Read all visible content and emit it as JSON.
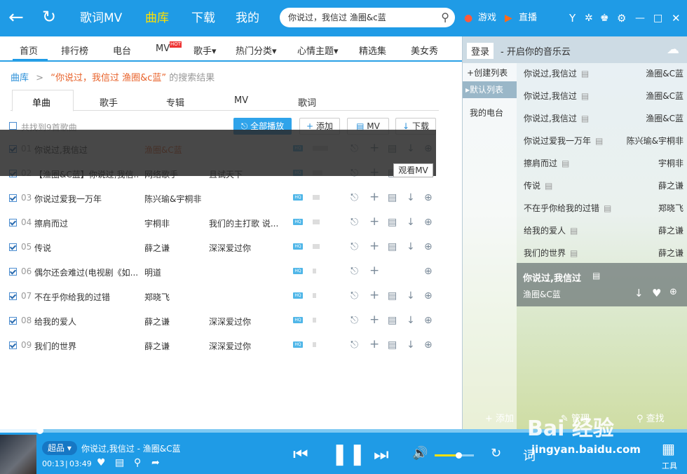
{
  "topbar": {
    "nav": [
      "歌词MV",
      "曲库",
      "下载",
      "我的"
    ],
    "active_nav": "曲库",
    "search_value": "你说过，我信过   渔圈&c蓝",
    "game_label": "游戏",
    "live_label": "直播"
  },
  "subnav": [
    "首页",
    "排行榜",
    "电台",
    "MV",
    "歌手▾",
    "热门分类▾",
    "心情主题▾",
    "精选集",
    "美女秀"
  ],
  "subnav_badge": "HOT",
  "breadcrumb": {
    "root": "曲库",
    "sep": ">",
    "query": "“你说过，我信过 渔圈&c蓝”",
    "suffix": "的搜索结果"
  },
  "tabs": [
    "单曲",
    "歌手",
    "专辑",
    "MV",
    "歌词"
  ],
  "header": {
    "found_text": "共找到9首歌曲",
    "play_all": "全部播放",
    "add": "添加",
    "mv": "MV",
    "download": "下载"
  },
  "songs": [
    {
      "no": "01",
      "title": "你说过,我信过",
      "artist": "渔圈&C蓝",
      "album": "",
      "bar": 0.9
    },
    {
      "no": "02",
      "title": "【渔圈&C蓝】你说过,我信...",
      "artist": "网络歌手",
      "album": "且试天下",
      "bar": 0.6
    },
    {
      "no": "03",
      "title": "你说过爱我一万年",
      "artist": "陈兴瑜&宇桐非",
      "album": "",
      "bar": 0.4
    },
    {
      "no": "04",
      "title": "擦肩而过",
      "artist": "宇桐非",
      "album": "我们的主打歌 说...",
      "bar": 0.4
    },
    {
      "no": "05",
      "title": "传说",
      "artist": "薛之谦",
      "album": "深深爱过你",
      "bar": 0.4
    },
    {
      "no": "06",
      "title": "偶尔还会难过(电视剧《如...",
      "artist": "明道",
      "album": "",
      "bar": 0.2
    },
    {
      "no": "07",
      "title": "不在乎你给我的过错",
      "artist": "郑晓飞",
      "album": "",
      "bar": 0.2
    },
    {
      "no": "08",
      "title": "给我的爱人",
      "artist": "薛之谦",
      "album": "深深爱过你",
      "bar": 0.2
    },
    {
      "no": "09",
      "title": "我们的世界",
      "artist": "薛之谦",
      "album": "深深爱过你",
      "bar": 0.2
    }
  ],
  "tooltip": "观看MV",
  "right_panel": {
    "login": "登录",
    "slogan": "- 开启你的音乐云",
    "create_list": "创建列表",
    "default_list": "默认列表",
    "my_radio": "我的电台",
    "playlist": [
      {
        "title": "你说过,我信过",
        "artist": "渔圈&C蓝"
      },
      {
        "title": "你说过,我信过",
        "artist": "渔圈&C蓝"
      },
      {
        "title": "你说过,我信过",
        "artist": "渔圈&C蓝"
      },
      {
        "title": "你说过爱我一万年",
        "artist": "陈兴瑜&宇桐非"
      },
      {
        "title": "擦肩而过",
        "artist": "宇桐非"
      },
      {
        "title": "传说",
        "artist": "薛之谦"
      },
      {
        "title": "不在乎你给我的过错",
        "artist": "郑晓飞"
      },
      {
        "title": "给我的爱人",
        "artist": "薛之谦"
      },
      {
        "title": "我们的世界",
        "artist": "薛之谦"
      }
    ],
    "now_title": "你说过,我信过",
    "now_artist": "渔圈&C蓝",
    "add_label": "添加",
    "manage_label": "管理",
    "search_label": "查找"
  },
  "player": {
    "quality": "超品",
    "song": "你说过,我信过 - 渔圈&C蓝",
    "current": "00:13",
    "total": "03:49",
    "lyric": "词",
    "tools": "工具",
    "progress": 0.058,
    "volume": 0.6
  },
  "watermark": {
    "line1": "Bai 经验",
    "line2": "jingyan.baidu.com"
  },
  "colors": {
    "blue": "#1f9be6",
    "orange": "#e8622a",
    "accent": "#ffe000"
  }
}
